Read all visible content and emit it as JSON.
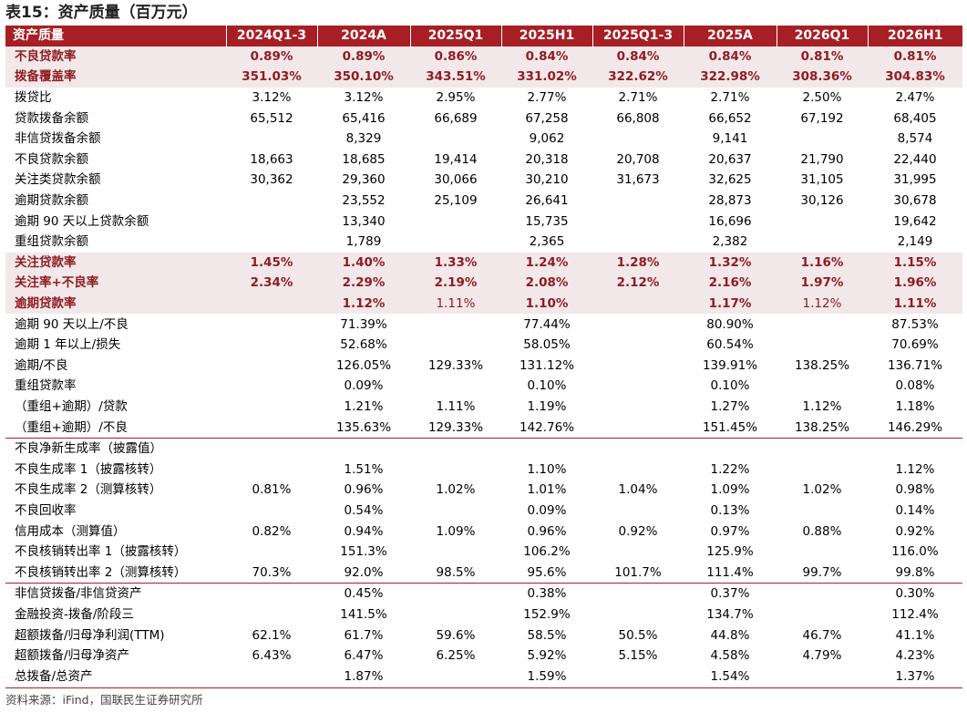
{
  "title": "表15：资产质量（百万元）",
  "columns": [
    "资产质量",
    "2024Q1-3",
    "2024A",
    "2025Q1",
    "2025H1",
    "2025Q1-3",
    "2025A",
    "2026Q1",
    "2026H1"
  ],
  "rows": [
    {
      "label": "不良贷款率",
      "style": "hl",
      "values": [
        "0.89%",
        "0.89%",
        "0.86%",
        "0.84%",
        "0.84%",
        "0.84%",
        "0.81%",
        "0.81%"
      ]
    },
    {
      "label": "拨备覆盖率",
      "style": "hl",
      "values": [
        "351.03%",
        "350.10%",
        "343.51%",
        "331.02%",
        "322.62%",
        "322.98%",
        "308.36%",
        "304.83%"
      ]
    },
    {
      "label": "拨贷比",
      "style": "plain",
      "values": [
        "3.12%",
        "3.12%",
        "2.95%",
        "2.77%",
        "2.71%",
        "2.71%",
        "2.50%",
        "2.47%"
      ]
    },
    {
      "label": "贷款拨备余额",
      "style": "plain",
      "values": [
        "65,512",
        "65,416",
        "66,689",
        "67,258",
        "66,808",
        "66,652",
        "67,192",
        "68,405"
      ]
    },
    {
      "label": "非信贷拨备余额",
      "style": "plain",
      "values": [
        "",
        "8,329",
        "",
        "9,062",
        "",
        "9,141",
        "",
        "8,574"
      ]
    },
    {
      "label": "不良贷款余额",
      "style": "plain",
      "values": [
        "18,663",
        "18,685",
        "19,414",
        "20,318",
        "20,708",
        "20,637",
        "21,790",
        "22,440"
      ]
    },
    {
      "label": "关注类贷款余额",
      "style": "plain",
      "values": [
        "30,362",
        "29,360",
        "30,066",
        "30,210",
        "31,673",
        "32,625",
        "31,105",
        "31,995"
      ]
    },
    {
      "label": "逾期贷款余额",
      "style": "plain",
      "values": [
        "",
        "23,552",
        "25,109",
        "26,641",
        "",
        "28,873",
        "30,126",
        "30,678"
      ]
    },
    {
      "label": "逾期 90 天以上贷款余额",
      "style": "plain",
      "values": [
        "",
        "13,340",
        "",
        "15,735",
        "",
        "16,696",
        "",
        "19,642"
      ]
    },
    {
      "label": "重组贷款余额",
      "style": "plain",
      "values": [
        "",
        "1,789",
        "",
        "2,365",
        "",
        "2,382",
        "",
        "2,149"
      ]
    },
    {
      "label": "关注贷款率",
      "style": "hl",
      "values": [
        "1.45%",
        "1.40%",
        "1.33%",
        "1.24%",
        "1.28%",
        "1.32%",
        "1.16%",
        "1.15%"
      ]
    },
    {
      "label": "关注率+不良率",
      "style": "hl",
      "values": [
        "2.34%",
        "2.29%",
        "2.19%",
        "2.08%",
        "2.12%",
        "2.16%",
        "1.97%",
        "1.96%"
      ]
    },
    {
      "label": "逾期贷款率",
      "style": "hl",
      "light_cols": [
        2,
        6
      ],
      "values": [
        "",
        "1.12%",
        "1.11%",
        "1.10%",
        "",
        "1.17%",
        "1.12%",
        "1.11%"
      ]
    },
    {
      "label": "逾期 90 天以上/不良",
      "style": "plain",
      "values": [
        "",
        "71.39%",
        "",
        "77.44%",
        "",
        "80.90%",
        "",
        "87.53%"
      ]
    },
    {
      "label": "逾期 1 年以上/损失",
      "style": "plain",
      "values": [
        "",
        "52.68%",
        "",
        "58.05%",
        "",
        "60.54%",
        "",
        "70.69%"
      ]
    },
    {
      "label": "逾期/不良",
      "style": "plain",
      "values": [
        "",
        "126.05%",
        "129.33%",
        "131.12%",
        "",
        "139.91%",
        "138.25%",
        "136.71%"
      ]
    },
    {
      "label": "重组贷款率",
      "style": "plain",
      "values": [
        "",
        "0.09%",
        "",
        "0.10%",
        "",
        "0.10%",
        "",
        "0.08%"
      ]
    },
    {
      "label": "（重组+逾期）/贷款",
      "style": "plain",
      "values": [
        "",
        "1.21%",
        "1.11%",
        "1.19%",
        "",
        "1.27%",
        "1.12%",
        "1.18%"
      ]
    },
    {
      "label": "（重组+逾期）/不良",
      "style": "plain",
      "group_end": true,
      "values": [
        "",
        "135.63%",
        "129.33%",
        "142.76%",
        "",
        "151.45%",
        "138.25%",
        "146.29%"
      ]
    },
    {
      "label": "不良净新生成率（披露值）",
      "style": "plain",
      "values": [
        "",
        "",
        "",
        "",
        "",
        "",
        "",
        ""
      ]
    },
    {
      "label": "不良生成率 1（披露核转）",
      "style": "plain",
      "values": [
        "",
        "1.51%",
        "",
        "1.10%",
        "",
        "1.22%",
        "",
        "1.12%"
      ]
    },
    {
      "label": "不良生成率 2（测算核转）",
      "style": "plain",
      "values": [
        "0.81%",
        "0.96%",
        "1.02%",
        "1.01%",
        "1.04%",
        "1.09%",
        "1.02%",
        "0.98%"
      ]
    },
    {
      "label": "不良回收率",
      "style": "plain",
      "values": [
        "",
        "0.54%",
        "",
        "0.09%",
        "",
        "0.13%",
        "",
        "0.14%"
      ]
    },
    {
      "label": "信用成本（测算值）",
      "style": "plain",
      "values": [
        "0.82%",
        "0.94%",
        "1.09%",
        "0.96%",
        "0.92%",
        "0.97%",
        "0.88%",
        "0.92%"
      ]
    },
    {
      "label": "不良核销转出率 1（披露核转）",
      "style": "plain",
      "values": [
        "",
        "151.3%",
        "",
        "106.2%",
        "",
        "125.9%",
        "",
        "116.0%"
      ]
    },
    {
      "label": "不良核销转出率 2（测算核转）",
      "style": "plain",
      "group_end": true,
      "values": [
        "70.3%",
        "92.0%",
        "98.5%",
        "95.6%",
        "101.7%",
        "111.4%",
        "99.7%",
        "99.8%"
      ]
    },
    {
      "label": "非信贷拨备/非信贷资产",
      "style": "plain",
      "values": [
        "",
        "0.45%",
        "",
        "0.38%",
        "",
        "0.37%",
        "",
        "0.30%"
      ]
    },
    {
      "label": "金融投资-拨备/阶段三",
      "style": "plain",
      "values": [
        "",
        "141.5%",
        "",
        "152.9%",
        "",
        "134.7%",
        "",
        "112.4%"
      ]
    },
    {
      "label": "超额拨备/归母净利润(TTM)",
      "style": "plain",
      "values": [
        "62.1%",
        "61.7%",
        "59.6%",
        "58.5%",
        "50.5%",
        "44.8%",
        "46.7%",
        "41.1%"
      ]
    },
    {
      "label": "超额拨备/归母净资产",
      "style": "plain",
      "values": [
        "6.43%",
        "6.47%",
        "6.25%",
        "5.92%",
        "5.15%",
        "4.58%",
        "4.79%",
        "4.23%"
      ]
    },
    {
      "label": "总拨备/总资产",
      "style": "plain",
      "values": [
        "",
        "1.87%",
        "",
        "1.59%",
        "",
        "1.54%",
        "",
        "1.37%"
      ]
    }
  ],
  "source": "资料来源：iFind，国联民生证券研究所",
  "colors": {
    "header_bg": "#a71f24",
    "highlight_bg": "#f2e8e9",
    "highlight_text": "#8f1d22"
  }
}
